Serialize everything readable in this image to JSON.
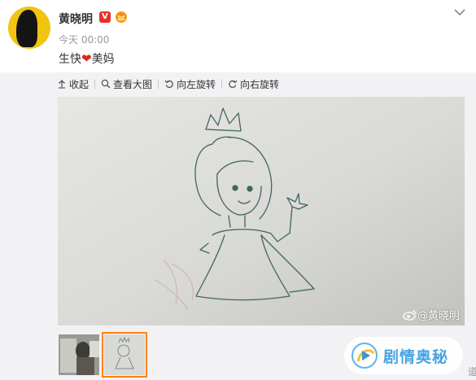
{
  "post": {
    "username": "黄晓明",
    "v_badge": "V",
    "timestamp": "今天 00:00",
    "text_before": "生快",
    "text_after": "美妈"
  },
  "toolbar": {
    "collapse": "收起",
    "view_large": "查看大图",
    "rotate_left": "向左旋转",
    "rotate_right": "向右旋转"
  },
  "photo": {
    "watermark": "@黄晓明"
  },
  "brand": {
    "text": "剧情奥秘"
  },
  "edge_text": "道",
  "colors": {
    "accent_orange": "#ff8200",
    "verified_red": "#e8302a",
    "brand_blue": "#4aa3e0"
  }
}
